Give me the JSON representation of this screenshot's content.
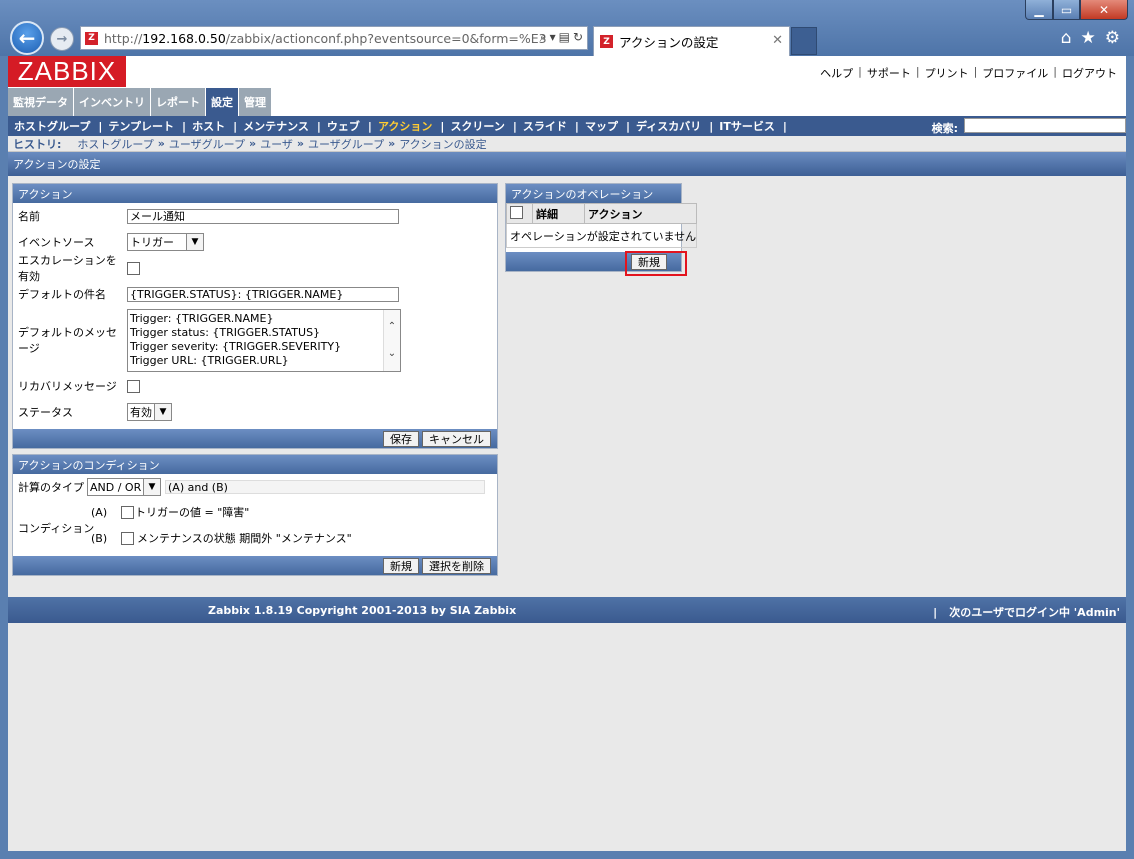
{
  "browser": {
    "url_prefix": "http://",
    "url_host": "192.168.0.50",
    "url_path": "/zabbix/actionconf.php?eventsource=0&form=%E3",
    "tab_title": "アクションの設定",
    "favicon_letter": "Z"
  },
  "header": {
    "logo": "ZABBIX",
    "links": [
      "ヘルプ",
      "サポート",
      "プリント",
      "プロファイル",
      "ログアウト"
    ]
  },
  "main_menu": [
    "監視データ",
    "インベントリ",
    "レポート",
    "設定",
    "管理"
  ],
  "sub_menu": [
    "ホストグループ",
    "テンプレート",
    "ホスト",
    "メンテナンス",
    "ウェブ",
    "アクション",
    "スクリーン",
    "スライド",
    "マップ",
    "ディスカバリ",
    "ITサービス"
  ],
  "search_label": "検索:",
  "history": {
    "label": "ヒストリ:",
    "items": [
      "ホストグループ",
      "ユーザグループ",
      "ユーザ",
      "ユーザグループ",
      "アクションの設定"
    ],
    "separator": "»"
  },
  "page_title": "アクションの設定",
  "action_panel": {
    "title": "アクション",
    "name_label": "名前",
    "name_value": "メール通知",
    "event_source_label": "イベントソース",
    "event_source_value": "トリガー",
    "escalation_label": "エスカレーションを有効",
    "default_subject_label": "デフォルトの件名",
    "default_subject_value": "{TRIGGER.STATUS}: {TRIGGER.NAME}",
    "default_message_label": "デフォルトのメッセージ",
    "default_message_lines": [
      "Trigger: {TRIGGER.NAME}",
      "Trigger status: {TRIGGER.STATUS}",
      "Trigger severity: {TRIGGER.SEVERITY}",
      "Trigger URL: {TRIGGER.URL}"
    ],
    "recovery_label": "リカバリメッセージ",
    "status_label": "ステータス",
    "status_value": "有効",
    "save_button": "保存",
    "cancel_button": "キャンセル"
  },
  "condition_panel": {
    "title": "アクションのコンディション",
    "calc_type_label": "計算のタイプ",
    "calc_type_value": "AND / OR",
    "calc_expression": "(A) and (B)",
    "conditions_label": "コンディション",
    "conditions": [
      {
        "id": "(A)",
        "text": "トリガーの値 = \"障害\""
      },
      {
        "id": "(B)",
        "text": "メンテナンスの状態 期間外 \"メンテナンス\""
      }
    ],
    "new_button": "新規",
    "delete_button": "選択を削除"
  },
  "operations_panel": {
    "title": "アクションのオペレーション",
    "col_detail": "詳細",
    "col_action": "アクション",
    "empty_text": "オペレーションが設定されていません",
    "new_button": "新規"
  },
  "footer": {
    "copyright": "Zabbix 1.8.19 Copyright 2001-2013 by SIA Zabbix",
    "login_status": "次のユーザでログイン中 'Admin'"
  },
  "colors": {
    "brand_red": "#d51b25",
    "nav_blue": "#3a5a8f",
    "active_submenu": "#ffcc33",
    "highlight_box": "#e3141e"
  }
}
